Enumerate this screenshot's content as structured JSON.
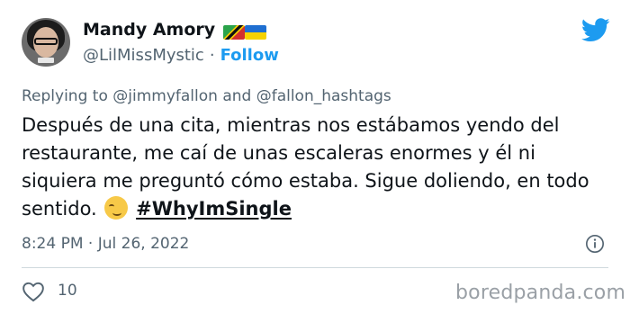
{
  "author": {
    "display_name": "Mandy Amory",
    "handle": "@LilMissMystic",
    "separator": "·",
    "follow_label": "Follow",
    "flags": [
      "saint-kitts-and-nevis-flag-icon",
      "ukraine-flag-icon"
    ],
    "avatar_icon": "avatar"
  },
  "brand": {
    "icon": "twitter-bird-icon",
    "color": "#1d9bf0"
  },
  "reply": {
    "prefix": "Replying to",
    "mention_1": "@jimmyfallon",
    "conjunction": "and",
    "mention_2": "@fallon_hashtags"
  },
  "tweet": {
    "text": "Después de una cita, mientras nos estábamos yendo del restaurante, me caí de unas escaleras enormes y él ni siquiera me preguntó cómo estaba. Sigue doliendo, en todo sentido.",
    "emoji_icon": "smirking-face-emoji",
    "hashtag": "#WhyImSingle"
  },
  "meta": {
    "time": "8:24 PM",
    "separator": "·",
    "date": "Jul 26, 2022",
    "info_icon": "info-icon"
  },
  "actions": {
    "like_icon": "heart-icon",
    "like_count": "10"
  },
  "watermark": "boredpanda.com",
  "colors": {
    "text": "#0f1419",
    "secondary": "#536471",
    "accent": "#1d9bf0",
    "divider": "#cfd9de"
  }
}
